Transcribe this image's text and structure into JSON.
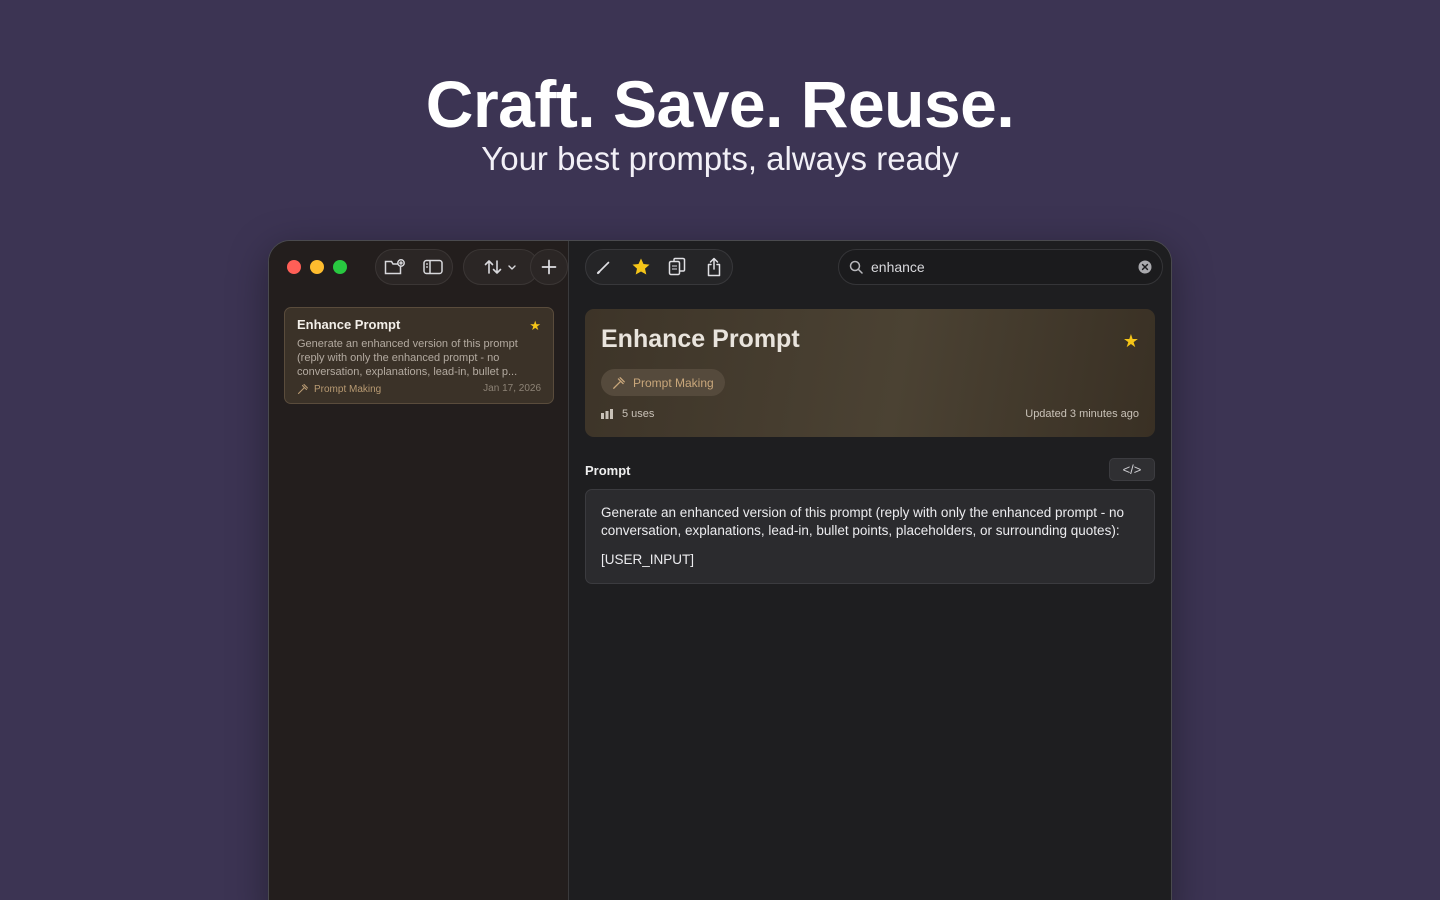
{
  "hero": {
    "title": "Craft. Save. Reuse.",
    "subtitle": "Your best prompts, always ready"
  },
  "toolbar_left": {
    "icons": [
      "new-folder-icon",
      "sidebar-toggle-icon",
      "sort-icon",
      "chevron-down-icon",
      "plus-icon"
    ]
  },
  "toolbar_right": {
    "icons": [
      "pencil-icon",
      "star-icon",
      "copy-icon",
      "share-icon"
    ]
  },
  "search": {
    "value": "enhance",
    "placeholder": "Search"
  },
  "list": {
    "items": [
      {
        "title": "Enhance Prompt",
        "starred": true,
        "preview": "Generate an enhanced version of this prompt (reply with only the enhanced prompt - no conversation, explanations, lead-in, bullet p...",
        "category": "Prompt Making",
        "date": "Jan 17, 2026"
      }
    ]
  },
  "detail": {
    "title": "Enhance Prompt",
    "category": "Prompt Making",
    "uses": "5 uses",
    "updated": "Updated 3 minutes ago",
    "prompt_label": "Prompt",
    "code_toggle": "</>",
    "prompt_text_1": "Generate an enhanced version of this prompt (reply with only the enhanced prompt - no conversation, explanations, lead-in, bullet points, placeholders, or surrounding quotes):",
    "prompt_text_2": "[USER_INPUT]"
  },
  "colors": {
    "background": "#3c3453",
    "accent_star": "#f5c518",
    "card_bg": "#3b3228",
    "category_text": "#c9a77b"
  }
}
